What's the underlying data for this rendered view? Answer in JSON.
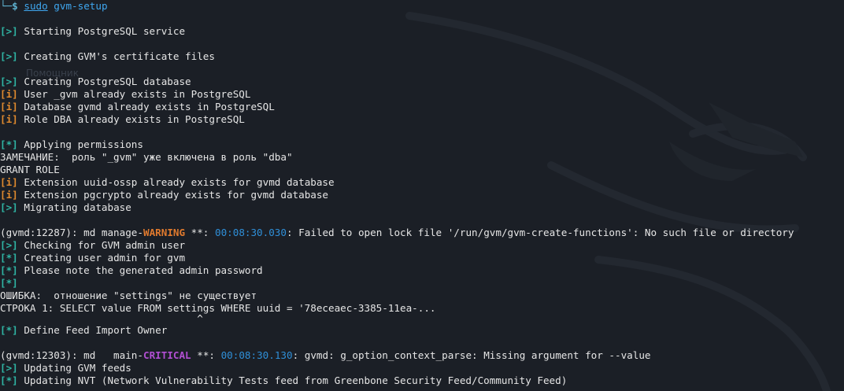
{
  "prompt": {
    "corner": "└─",
    "dollar": "$",
    "command": "sudo",
    "argument": "gvm-setup"
  },
  "background_watermark": "Помощник",
  "lines": [
    {
      "tag": "[>]",
      "text": " Starting PostgreSQL service"
    },
    {
      "tag": "[>]",
      "text": " Creating GVM's certificate files"
    },
    {
      "tag": "[>]",
      "text": " Creating PostgreSQL database"
    },
    {
      "tag": "[i]",
      "text": " User _gvm already exists in PostgreSQL"
    },
    {
      "tag": "[i]",
      "text": " Database gvmd already exists in PostgreSQL"
    },
    {
      "tag": "[i]",
      "text": " Role DBA already exists in PostgreSQL"
    },
    {
      "tag": "[*]",
      "text": " Applying permissions"
    },
    {
      "text": "ЗАМЕЧАНИЕ:  роль \"_gvm\" уже включена в роль \"dba\""
    },
    {
      "text": "GRANT ROLE"
    },
    {
      "tag": "[i]",
      "text": " Extension uuid-ossp already exists for gvmd database"
    },
    {
      "tag": "[i]",
      "text": " Extension pgcrypto already exists for gvmd database"
    },
    {
      "tag": "[>]",
      "text": " Migrating database"
    },
    {
      "prefix": "(gvmd:12287): md manage-",
      "level": "WARNING",
      "mid": " **: ",
      "time": "00:08:30.030",
      "suffix": ": Failed to open lock file '/run/gvm/gvm-create-functions': No such file or directory"
    },
    {
      "tag": "[>]",
      "text": " Checking for GVM admin user"
    },
    {
      "tag": "[*]",
      "text": " Creating user admin for gvm"
    },
    {
      "tag": "[*]",
      "text": " Please note the generated admin password"
    },
    {
      "tag": "[*]",
      "text": ""
    },
    {
      "text": "ОШИБКА:  отношение \"settings\" не существует"
    },
    {
      "text": "СТРОКА 1: SELECT value FROM settings WHERE uuid = '78eceaec-3385-11ea-..."
    },
    {
      "text": "                                 ^"
    },
    {
      "tag": "[*]",
      "text": " Define Feed Import Owner"
    },
    {
      "prefix": "(gvmd:12303): md   main-",
      "level": "CRITICAL",
      "mid": " **: ",
      "time": "00:08:30.130",
      "suffix": ": gvmd: g_option_context_parse: Missing argument for --value"
    },
    {
      "tag": "[>]",
      "text": " Updating GVM feeds"
    },
    {
      "tag": "[*]",
      "text": " Updating NVT (Network Vulnerability Tests feed from Greenbone Security Feed/Community Feed)"
    }
  ]
}
